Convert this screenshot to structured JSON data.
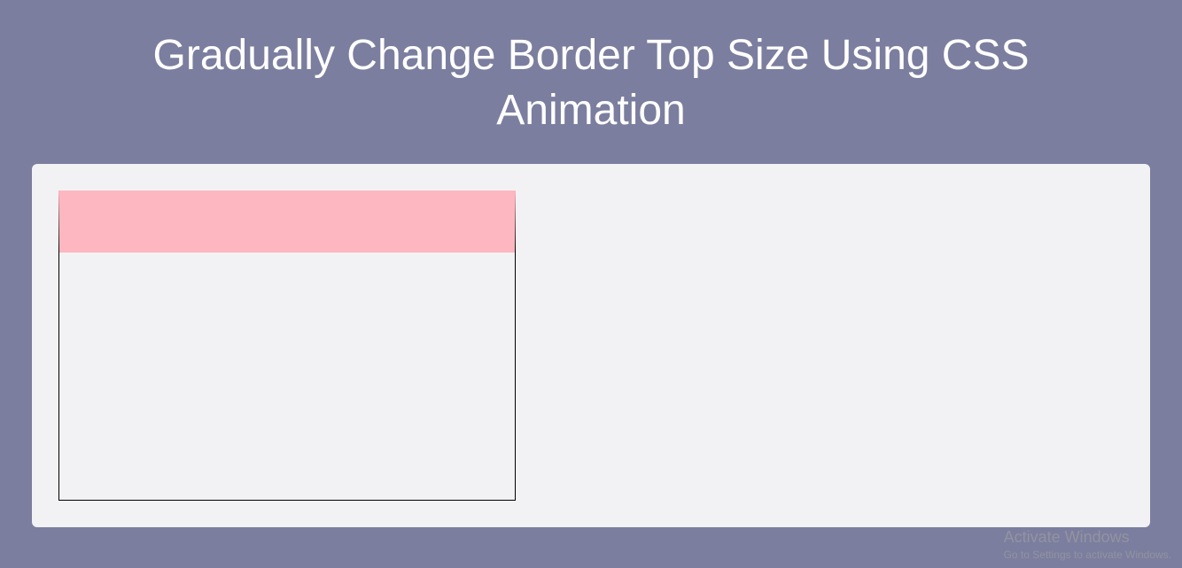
{
  "header": {
    "title": "Gradually Change Border Top Size Using CSS Animation"
  },
  "demo": {
    "border_top_color": "#fdb7c0",
    "border_top_width_px": 70,
    "box_border_color": "#000000"
  },
  "watermark": {
    "title": "Activate Windows",
    "subtitle": "Go to Settings to activate Windows."
  },
  "colors": {
    "page_bg": "#7b7e9e",
    "panel_bg": "#f2f2f4",
    "title_text": "#ffffff"
  }
}
